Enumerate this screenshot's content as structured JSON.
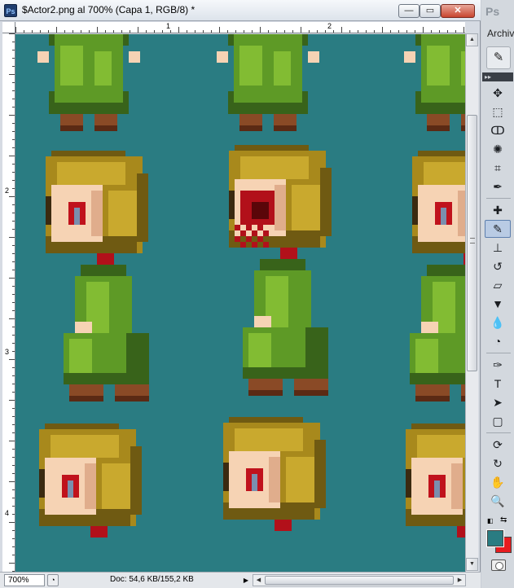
{
  "window": {
    "title": "$Actor2.png al 700% (Capa 1, RGB/8) *",
    "app_badge": "Ps",
    "minimize": "—",
    "maximize": "▭",
    "close": "✕"
  },
  "rulers": {
    "horizontal_labels": [
      "1",
      "2"
    ],
    "vertical_labels": [
      "2",
      "3",
      "4"
    ]
  },
  "canvas": {
    "background_color": "#2a7c82"
  },
  "statusbar": {
    "zoom": "700%",
    "doc_size": "Doc: 54,6 KB/155,2 KB",
    "menu_arrow": "▶"
  },
  "right_panel": {
    "app_badge": "Ps",
    "archivo_tab": "Archiv",
    "panel_collapse": "▸▸",
    "brush_preset_icon": "brush-icon"
  },
  "tools": [
    {
      "name": "move-tool-icon",
      "glyph": "✥"
    },
    {
      "name": "marquee-tool-icon",
      "glyph": "⬚"
    },
    {
      "name": "lasso-tool-icon",
      "glyph": "ↀ"
    },
    {
      "name": "quick-selection-tool-icon",
      "glyph": "✺"
    },
    {
      "name": "crop-tool-icon",
      "glyph": "⌗"
    },
    {
      "name": "eyedropper-tool-icon",
      "glyph": "✒"
    },
    {
      "sep": true
    },
    {
      "name": "healing-brush-tool-icon",
      "glyph": "✚"
    },
    {
      "name": "brush-tool-icon",
      "glyph": "✎",
      "active": true
    },
    {
      "name": "clone-stamp-tool-icon",
      "glyph": "⊥"
    },
    {
      "name": "history-brush-tool-icon",
      "glyph": "↺"
    },
    {
      "name": "eraser-tool-icon",
      "glyph": "▱"
    },
    {
      "name": "paint-bucket-tool-icon",
      "glyph": "▼"
    },
    {
      "name": "blur-tool-icon",
      "glyph": "💧"
    },
    {
      "name": "dodge-tool-icon",
      "glyph": "◔"
    },
    {
      "sep": true
    },
    {
      "name": "pen-tool-icon",
      "glyph": "✑"
    },
    {
      "name": "type-tool-icon",
      "glyph": "T"
    },
    {
      "name": "path-selection-tool-icon",
      "glyph": "➤"
    },
    {
      "name": "shape-tool-icon",
      "glyph": "▢"
    },
    {
      "sep": true
    },
    {
      "name": "3d-rotate-tool-icon",
      "glyph": "⟳"
    },
    {
      "name": "3d-orbit-tool-icon",
      "glyph": "↻"
    },
    {
      "name": "hand-tool-icon",
      "glyph": "✋"
    },
    {
      "name": "zoom-tool-icon",
      "glyph": "🔍"
    }
  ],
  "colors": {
    "foreground": "#2a7c82",
    "background": "#e61c1f"
  },
  "sprite_palette": {
    "bg": "#2a7c82",
    "dress": "#5e9a26",
    "dress_light": "#82bc33",
    "dress_dark": "#38631a",
    "hair": "#a8891c",
    "hair_light": "#c9a92e",
    "hair_dark": "#6f5a12",
    "skin": "#f6d3b4",
    "skin_shadow": "#e0ad8c",
    "eye": "#c0121c",
    "shoe": "#8a4a26",
    "shoe_dark": "#5b2a14",
    "outline": "#3b2a10",
    "blood": "#b2101a",
    "blood_dark": "#5a0609"
  }
}
